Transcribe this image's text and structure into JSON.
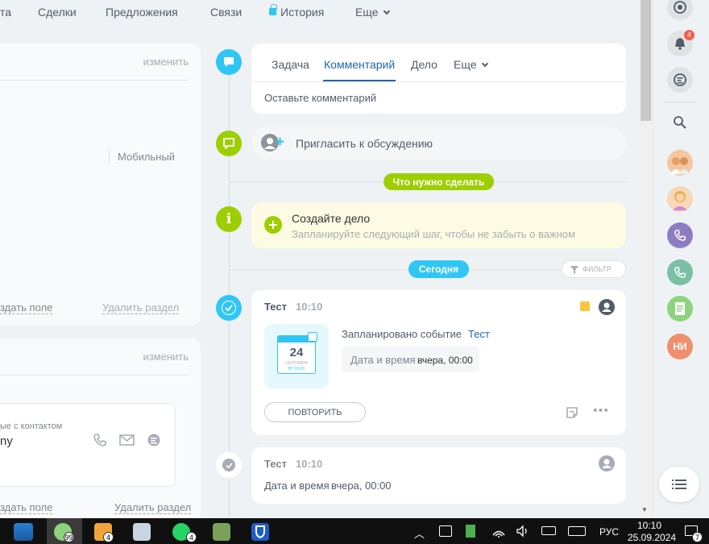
{
  "nav": {
    "items": [
      "та",
      "Сделки",
      "Предложения",
      "Связи",
      "История",
      "Еще"
    ]
  },
  "left": {
    "panel1": {
      "edit": "изменить",
      "mobile": "Мобильный",
      "add_field": "здать поле",
      "delete_section": "Удалить раздел"
    },
    "panel2": {
      "edit": "изменить",
      "contact_caption": "ые с контактом",
      "contact_value": "ny",
      "add_field": "здать поле",
      "delete_section": "Удалить раздел"
    }
  },
  "composer": {
    "tabs": [
      "Задача",
      "Комментарий",
      "Дело",
      "Еще"
    ],
    "placeholder": "Оставьте комментарий"
  },
  "invite": {
    "label": "Пригласить к обсуждению"
  },
  "todo_pill": "Что нужно сделать",
  "create_deal": {
    "title": "Создайте дело",
    "subtitle": "Запланируйте следующий шаг, чтобы не забыть о важном"
  },
  "today_pill": "Сегодня",
  "filter": "ФИЛЬТР",
  "event1": {
    "title": "Тест",
    "time": "10:10",
    "calendar_day": "24",
    "calendar_month": "СЕНТЯБРЯ",
    "calendar_time": "ВТ 00:00",
    "desc_label": "Запланировано событие",
    "desc_link": "Тест",
    "datetime_label": "Дата и время",
    "datetime_value": "вчера, 00:00",
    "repeat": "ПОВТОРИТЬ"
  },
  "event2": {
    "title": "Тест",
    "time": "10:10",
    "datetime_label": "Дата и время",
    "datetime_value": "вчера, 00:00"
  },
  "sidebar": {
    "notif_count": "4",
    "avatar_initials": "НИ"
  },
  "taskbar": {
    "badges": [
      "99",
      "4",
      "4"
    ],
    "lang": "РУС",
    "time": "10:10",
    "date": "25.09.2024",
    "notif": "7"
  },
  "colors": {
    "accent": "#2fc6f6",
    "green": "#9dcf00",
    "link": "#2067b0"
  }
}
